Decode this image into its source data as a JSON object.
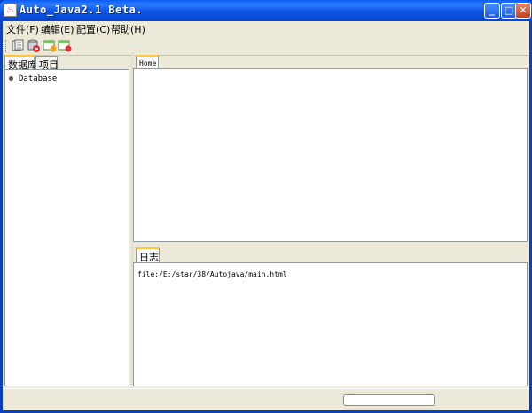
{
  "window": {
    "title": "Auto_Java2.1 Beta.",
    "minimize_icon": "minimize-icon",
    "maximize_icon": "maximize-icon",
    "close_icon": "close-icon"
  },
  "menu": {
    "items": [
      {
        "label": "文件(F)"
      },
      {
        "label": "编辑(E)"
      },
      {
        "label": "配置(C)"
      },
      {
        "label": "帮助(H)"
      }
    ]
  },
  "toolbar": {
    "icons": [
      "database-list-icon",
      "database-delete-icon",
      "table-add-icon",
      "table-remove-icon"
    ]
  },
  "left_panel": {
    "tabs": [
      {
        "label": "数据库"
      },
      {
        "label": "项目"
      }
    ],
    "tree": [
      {
        "label": "Database"
      }
    ]
  },
  "editor": {
    "tabs": [
      {
        "label": "Home"
      }
    ]
  },
  "log": {
    "tabs": [
      {
        "label": "日志"
      }
    ],
    "lines": [
      "file:/E:/star/38/Autojava/main.html"
    ]
  },
  "colors": {
    "accent": "#ffc83c",
    "window_bg": "#ece9d8",
    "titlebar": "#0a5cf6",
    "close_button": "#c3401d"
  }
}
